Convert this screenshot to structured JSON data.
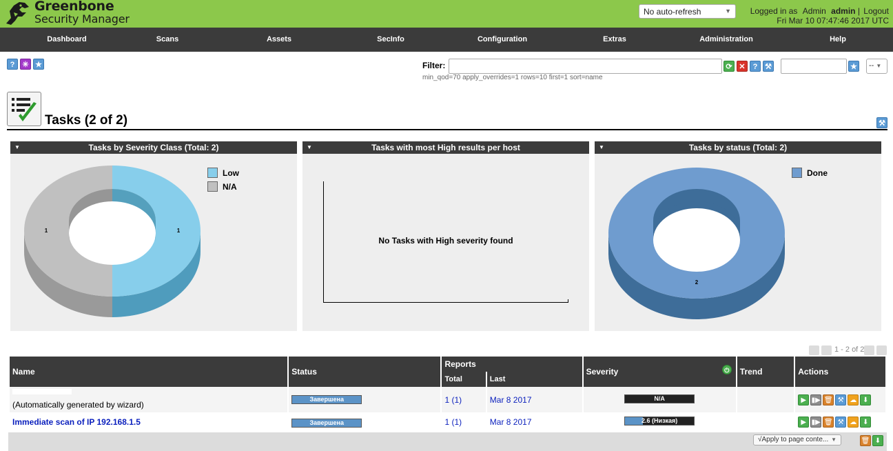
{
  "app": {
    "title_line1": "Greenbone",
    "title_line2": "Security Manager"
  },
  "header": {
    "refresh_select": "No auto-refresh",
    "logged_in_label": "Logged in as",
    "role": "Admin",
    "user": "admin",
    "separator": "|",
    "logout": "Logout",
    "datetime": "Fri Mar 10 07:47:46 2017 UTC"
  },
  "nav": {
    "items": [
      "Dashboard",
      "Scans",
      "Assets",
      "SecInfo",
      "Configuration",
      "Extras",
      "Administration",
      "Help"
    ]
  },
  "filter": {
    "label": "Filter:",
    "value": "",
    "description": "min_qod=70 apply_overrides=1 rows=10 first=1 sort=name",
    "name_value": "",
    "select_value": "--"
  },
  "section": {
    "title": "Tasks (2 of 2)"
  },
  "charts": [
    {
      "title": "Tasks by Severity Class (Total: 2)",
      "legend": [
        {
          "label": "Low",
          "color": "#87ceeb"
        },
        {
          "label": "N/A",
          "color": "#c0c0c0"
        }
      ],
      "slice_labels": [
        "1",
        "1"
      ]
    },
    {
      "title": "Tasks with most High results per host",
      "message": "No Tasks with High severity found"
    },
    {
      "title": "Tasks by status (Total: 2)",
      "legend": [
        {
          "label": "Done",
          "color": "#6f9ccf"
        }
      ],
      "slice_labels": [
        "2"
      ]
    }
  ],
  "chart_data": [
    {
      "type": "pie",
      "title": "Tasks by Severity Class (Total: 2)",
      "categories": [
        "Low",
        "N/A"
      ],
      "values": [
        1,
        1
      ]
    },
    {
      "type": "bar",
      "title": "Tasks with most High results per host",
      "categories": [],
      "values": []
    },
    {
      "type": "pie",
      "title": "Tasks by status (Total: 2)",
      "categories": [
        "Done"
      ],
      "values": [
        2
      ]
    }
  ],
  "pagination": {
    "text": "1 - 2 of 2"
  },
  "table": {
    "headers": {
      "name": "Name",
      "status": "Status",
      "reports": "Reports",
      "reports_total": "Total",
      "reports_last": "Last",
      "severity": "Severity",
      "trend": "Trend",
      "actions": "Actions"
    },
    "rows": [
      {
        "name": "",
        "comment": "(Automatically generated by wizard)",
        "status": "Завершена",
        "status_progress": 100,
        "total": "1",
        "total_paren": "(1)",
        "last": "Mar 8 2017",
        "severity": "N/A",
        "severity_fraction": 0
      },
      {
        "name": "Immediate scan of IP 192.168.1.5",
        "comment": "",
        "status": "Завершена",
        "status_progress": 100,
        "total": "1",
        "total_paren": "(1)",
        "last": "Mar 8 2017",
        "severity": "2.6 (Низкая)",
        "severity_fraction": 0.26
      }
    ],
    "footer_select": "√Apply to page conte..."
  },
  "colors": {
    "header_green": "#8cc84b",
    "dark_bar": "#3b3b3b",
    "link_blue": "#0a1fbd"
  }
}
